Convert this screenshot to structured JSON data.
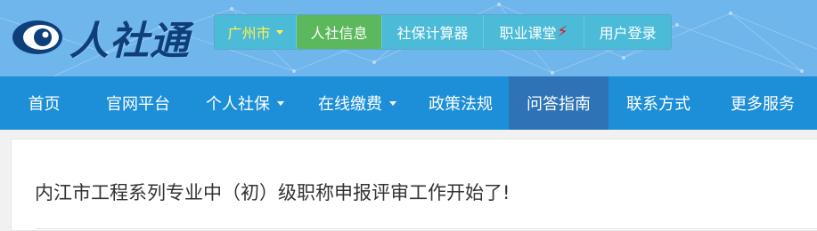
{
  "brand": {
    "logo_text": "人社通"
  },
  "topbar": {
    "city": "广州市",
    "news": "人社信息",
    "calculator": "社保计算器",
    "course": "职业课堂",
    "login": "用户登录"
  },
  "nav": {
    "home": "首页",
    "official": "官网平台",
    "personal": "个人社保",
    "payment": "在线缴费",
    "policy": "政策法规",
    "qa": "问答指南",
    "contact": "联系方式",
    "more": "更多服务"
  },
  "article": {
    "title": "内江市工程系列专业中（初）级职称申报评审工作开始了!"
  },
  "colors": {
    "header_bg": "#6fb6ec",
    "nav_bg": "#1c8fd8",
    "nav_active": "#2e73b5",
    "topbar_bg": "#4bbbd8",
    "topbar_active": "#5cb85c",
    "city_text": "#fff34a"
  }
}
